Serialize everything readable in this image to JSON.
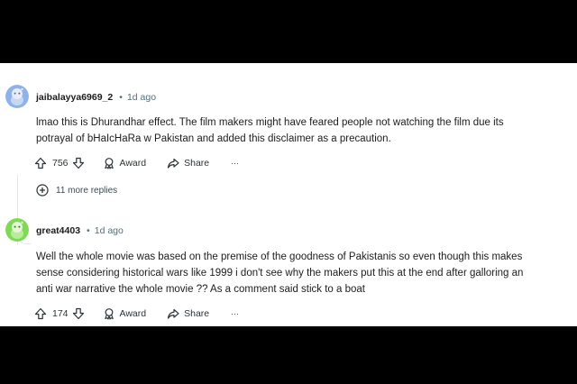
{
  "comments": [
    {
      "username": "jaibalayya6969_2",
      "age": "1d ago",
      "text_lines": [
        "lmao this is Dhurandhar effect. The film makers might have feared people not watching the film due its",
        "potrayal of bHaIcHaRa w Pakistan and added this disclaimer as a precaution."
      ],
      "votes": "756",
      "award_label": "Award",
      "share_label": "Share",
      "more_label": "···",
      "replies_label": "11 more replies",
      "avatar_color": "#8fb3e8"
    },
    {
      "username": "great4403",
      "age": "1d ago",
      "text_lines": [
        "Well the whole movie was based on the premise of the goodness of Pakistanis so even though this makes",
        "sense considering historical wars like 1999 i don't see why the makers put this at the end after galloring an",
        "anti war narrative the whole movie ?? As a comment said stick to a boat"
      ],
      "votes": "174",
      "award_label": "Award",
      "share_label": "Share",
      "more_label": "···",
      "avatar_color": "#7ed957"
    }
  ],
  "separator": "•"
}
